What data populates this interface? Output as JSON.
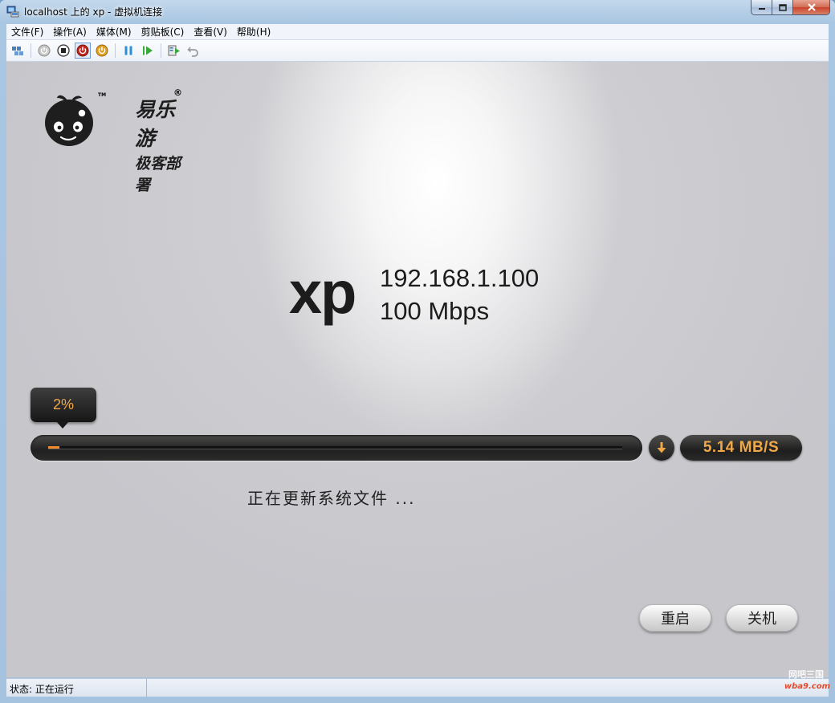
{
  "window": {
    "title": "localhost 上的 xp - 虚拟机连接",
    "buttons": [
      "minimize",
      "maximize",
      "close"
    ]
  },
  "menu": [
    "文件(F)",
    "操作(A)",
    "媒体(M)",
    "剪贴板(C)",
    "查看(V)",
    "帮助(H)"
  ],
  "toolbar": {
    "icons": [
      "ctrl-alt-del-icon",
      "start-icon",
      "turn-off-icon",
      "shutdown-icon",
      "save-icon",
      "pause-icon",
      "resume-icon",
      "snapshot-icon",
      "revert-icon"
    ]
  },
  "logo": {
    "name_line1": "易乐游",
    "name_line2": "极客部署",
    "tm": "TM",
    "reg": "®"
  },
  "machine": {
    "name": "xp",
    "ip": "192.168.1.100",
    "link_speed": "100 Mbps"
  },
  "progress": {
    "percent_label": "2%",
    "value": 0.02,
    "download_speed": "5.14 MB/S",
    "message": "正在更新系统文件 ..."
  },
  "actions": {
    "restart": "重启",
    "shutdown": "关机"
  },
  "statusbar": {
    "status": "状态: 正在运行"
  },
  "watermark": {
    "line1": "网吧三国",
    "line2": "wba9.com"
  },
  "colors": {
    "accent": "#f0a848",
    "progress_fill": "#ee8a2c",
    "title_bar": "#b3cde6"
  }
}
